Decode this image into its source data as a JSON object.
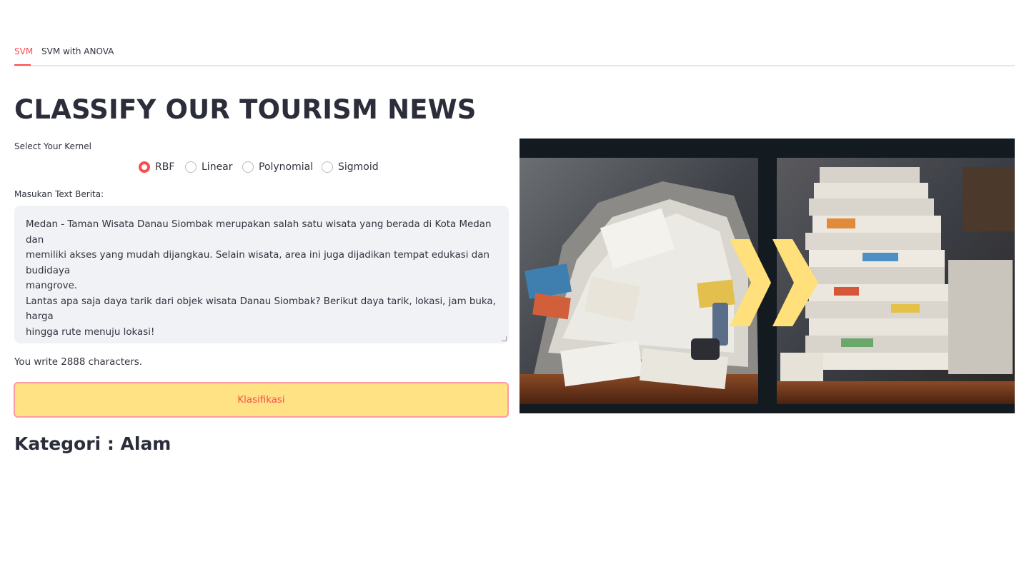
{
  "tabs": [
    {
      "label": "SVM",
      "active": true
    },
    {
      "label": "SVM with ANOVA",
      "active": false
    }
  ],
  "title": "CLASSIFY OUR TOURISM NEWS",
  "kernel": {
    "label": "Select Your Kernel",
    "options": [
      "RBF",
      "Linear",
      "Polynomial",
      "Sigmoid"
    ],
    "selected": "RBF"
  },
  "news_input": {
    "label": "Masukan Text Berita:",
    "value": "Medan - Taman Wisata Danau Siombak merupakan salah satu wisata yang berada di Kota Medan dan\nmemiliki akses yang mudah dijangkau. Selain wisata, area ini juga dijadikan tempat edukasi dan budidaya\nmangrove.\nLantas apa saja daya tarik dari objek wisata Danau Siombak? Berikut daya tarik, lokasi, jam buka, harga\nhingga rute menuju lokasi!\n\nDaya Tarik Wisata Danau Siombak\nDilansir dari laman resmi Universitas Sumatera Utara Danau Siombak memikat pengunjung dengan"
  },
  "char_count_text": "You write 2888 characters.",
  "classify_button": "Klasifikasi",
  "result_text": "Kategori : Alam",
  "image": {
    "description_icon": "newspaper-stacks-illustration",
    "arrow_color": "#ffe07a"
  }
}
